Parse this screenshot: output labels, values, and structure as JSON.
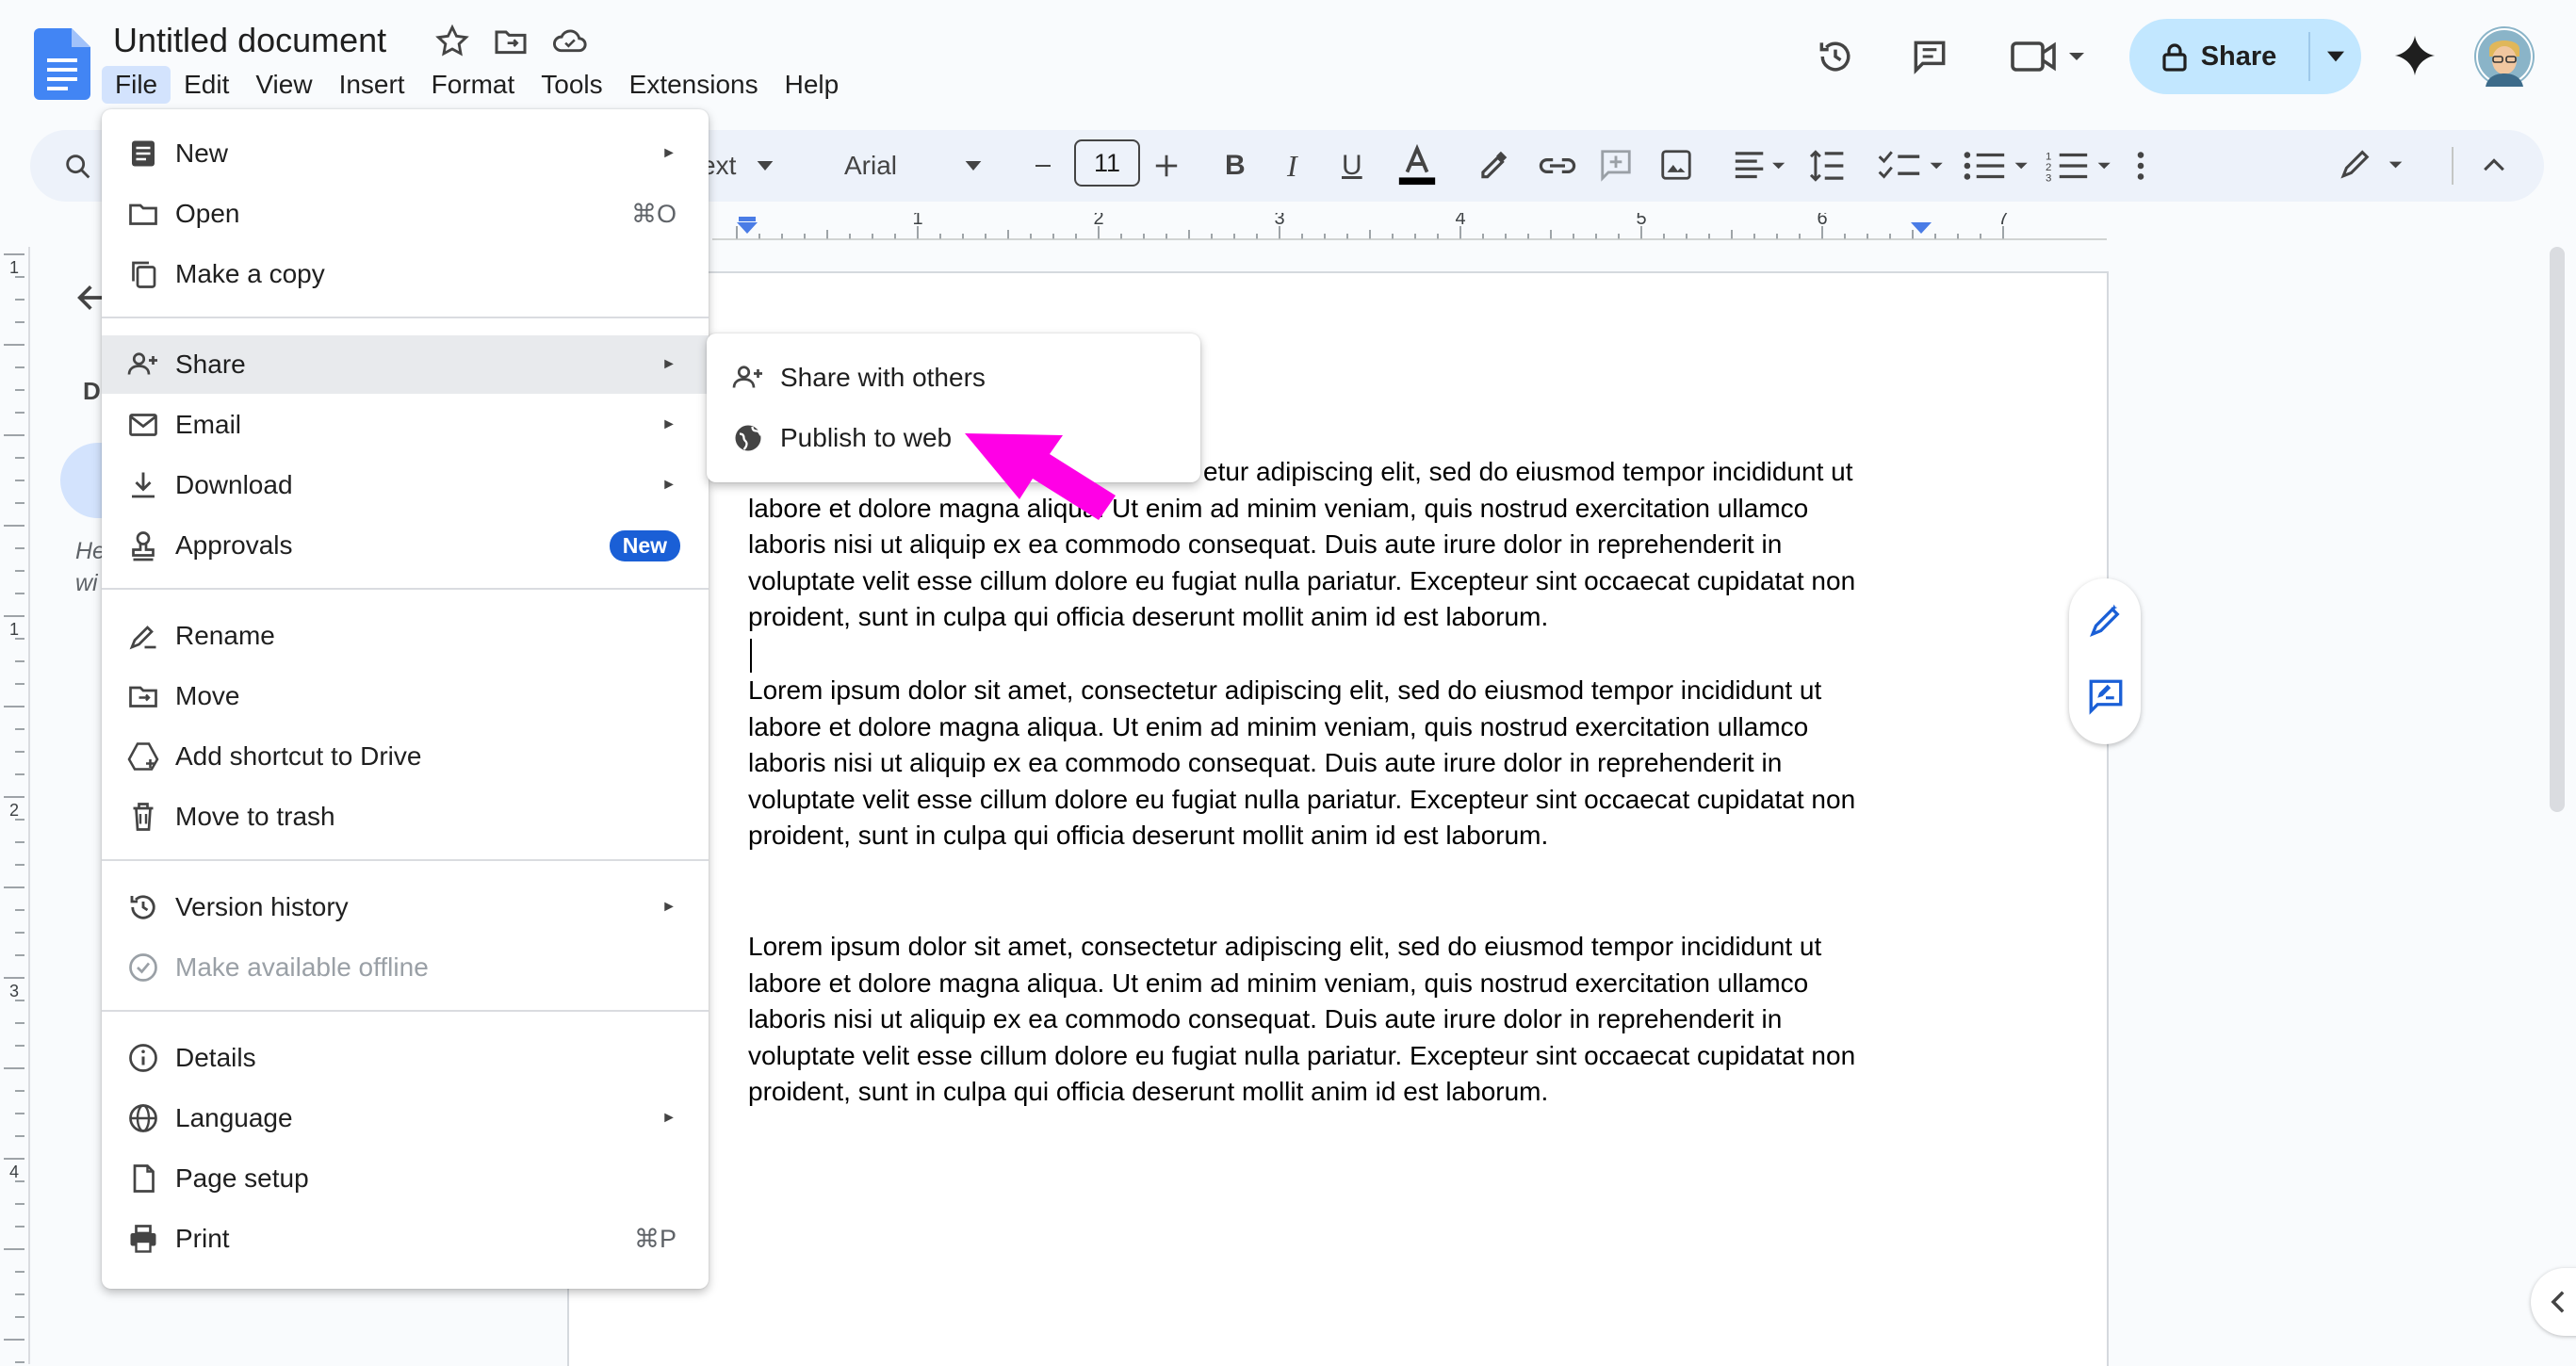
{
  "app": {
    "title": "Untitled document"
  },
  "menubar": [
    "File",
    "Edit",
    "View",
    "Insert",
    "Format",
    "Tools",
    "Extensions",
    "Help"
  ],
  "header": {
    "share_label": "Share"
  },
  "toolbar": {
    "style_fragment": "ext",
    "font": "Arial",
    "font_size": "11"
  },
  "ruler": {
    "h_marks": [
      "1",
      "2",
      "3",
      "4",
      "5",
      "6",
      "7"
    ],
    "v_marks": [
      "1",
      "1",
      "2",
      "3",
      "4"
    ]
  },
  "outline": {
    "letter": "D",
    "hint_line1": "He",
    "hint_line2": "wi"
  },
  "file_menu": {
    "new": "New",
    "open": "Open",
    "open_shortcut": "⌘O",
    "make_copy": "Make a copy",
    "share": "Share",
    "email": "Email",
    "download": "Download",
    "approvals": "Approvals",
    "approvals_badge": "New",
    "rename": "Rename",
    "move": "Move",
    "add_shortcut": "Add shortcut to Drive",
    "trash": "Move to trash",
    "version_history": "Version history",
    "offline": "Make available offline",
    "details": "Details",
    "language": "Language",
    "page_setup": "Page setup",
    "print": "Print",
    "print_shortcut": "⌘P"
  },
  "share_submenu": {
    "share_with_others": "Share with others",
    "publish_to_web": "Publish to web"
  },
  "document": {
    "para1_visible": [
      "etur adipiscing elit, sed do eiusmod tempor incididunt ut",
      "labore et dolore magna aliqua. Ut enim ad minim veniam, quis nostrud exercitation ullamco",
      "laboris nisi ut aliquip ex ea commodo consequat. Duis aute irure dolor in reprehenderit in",
      "voluptate velit esse cillum dolore eu fugiat nulla pariatur. Excepteur sint occaecat cupidatat non",
      "proident, sunt in culpa qui officia deserunt mollit anim id est laborum."
    ],
    "para2": [
      "Lorem ipsum dolor sit amet, consectetur adipiscing elit, sed do eiusmod tempor incididunt ut",
      "labore et dolore magna aliqua. Ut enim ad minim veniam, quis nostrud exercitation ullamco",
      "laboris nisi ut aliquip ex ea commodo consequat. Duis aute irure dolor in reprehenderit in",
      "voluptate velit esse cillum dolore eu fugiat nulla pariatur. Excepteur sint occaecat cupidatat non",
      "proident, sunt in culpa qui officia deserunt mollit anim id est laborum."
    ],
    "para3": [
      "Lorem ipsum dolor sit amet, consectetur adipiscing elit, sed do eiusmod tempor incididunt ut",
      "labore et dolore magna aliqua. Ut enim ad minim veniam, quis nostrud exercitation ullamco",
      "laboris nisi ut aliquip ex ea commodo consequat. Duis aute irure dolor in reprehenderit in",
      "voluptate velit esse cillum dolore eu fugiat nulla pariatur. Excepteur sint occaecat cupidatat non",
      "proident, sunt in culpa qui officia deserunt mollit anim id est laborum."
    ]
  },
  "colors": {
    "accent": "#1a73e8",
    "share_bg": "#c2e7ff",
    "annotation_arrow": "#ff00e6",
    "menu_highlight": "#e8eaed"
  }
}
